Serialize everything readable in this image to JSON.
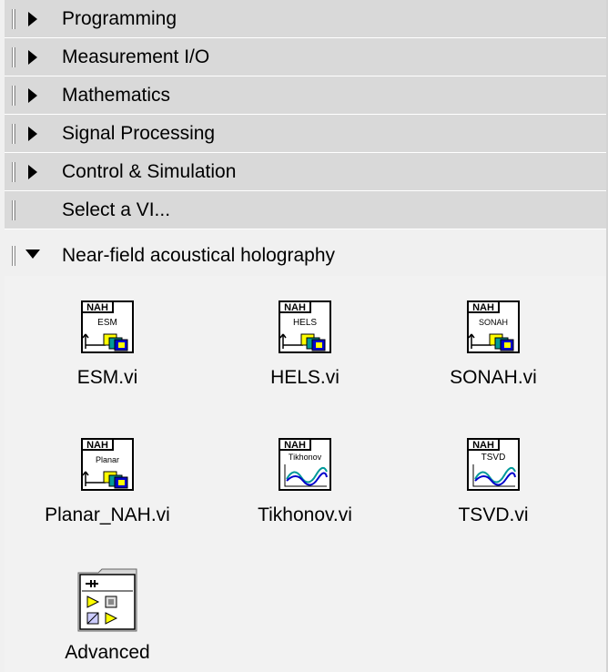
{
  "categories": [
    {
      "label": "Programming",
      "expandable": true
    },
    {
      "label": "Measurement I/O",
      "expandable": true
    },
    {
      "label": "Mathematics",
      "expandable": true
    },
    {
      "label": "Signal Processing",
      "expandable": true
    },
    {
      "label": "Control & Simulation",
      "expandable": true
    },
    {
      "label": "Select a VI...",
      "expandable": false
    },
    {
      "label": "Near-field acoustical holography",
      "expanded": true
    }
  ],
  "vis": [
    {
      "label": "ESM.vi",
      "icon_banner": "NAH",
      "icon_text": "ESM",
      "icon": "nah-vi-icon"
    },
    {
      "label": "HELS.vi",
      "icon_banner": "NAH",
      "icon_text": "HELS",
      "icon": "nah-vi-icon"
    },
    {
      "label": "SONAH.vi",
      "icon_banner": "NAH",
      "icon_text": "SONAH",
      "icon": "nah-vi-icon"
    },
    {
      "label": "Planar_NAH.vi",
      "icon_banner": "NAH",
      "icon_text": "Planar",
      "icon": "nah-vi-icon"
    },
    {
      "label": "Tikhonov.vi",
      "icon_banner": "NAH",
      "icon_text": "Tikhonov",
      "icon": "nah-wave-icon"
    },
    {
      "label": "TSVD.vi",
      "icon_banner": "NAH",
      "icon_text": "TSVD",
      "icon": "nah-wave-icon"
    },
    {
      "label": "Advanced",
      "icon": "subpalette-folder-icon"
    }
  ],
  "colors": {
    "category_bg": "#d9d9d9",
    "panel_bg": "#f2f2f2",
    "icon_border": "#000000",
    "icon_yellow": "#ffff00",
    "icon_teal": "#009999",
    "icon_blue": "#0000cc"
  }
}
